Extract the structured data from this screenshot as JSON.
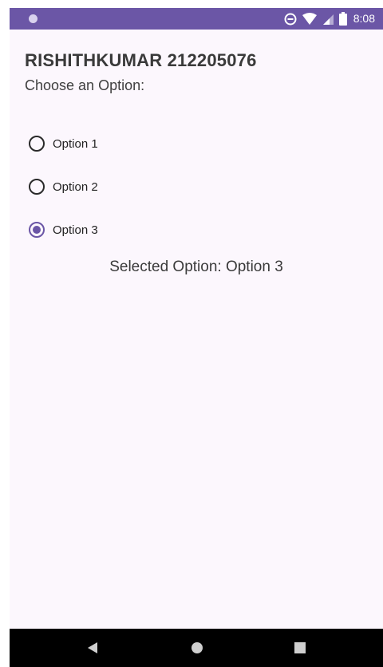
{
  "status_bar": {
    "time": "8:08",
    "icons": [
      "notification-dot-icon",
      "do-not-disturb-icon",
      "wifi-icon",
      "cell-signal-icon",
      "battery-icon"
    ]
  },
  "app": {
    "title": "RISHITHKUMAR 212205076",
    "prompt": "Choose an Option:",
    "options": [
      {
        "label": "Option 1",
        "selected": false
      },
      {
        "label": "Option 2",
        "selected": false
      },
      {
        "label": "Option 3",
        "selected": true
      }
    ],
    "selected_text": "Selected Option: Option 3"
  },
  "nav_bar": {
    "buttons": [
      "back-icon",
      "home-icon",
      "recents-icon"
    ]
  },
  "colors": {
    "status_bar": "#6b56a6",
    "background": "#fcf7fd",
    "accent": "#6b56a6",
    "nav_bar": "#000000"
  }
}
